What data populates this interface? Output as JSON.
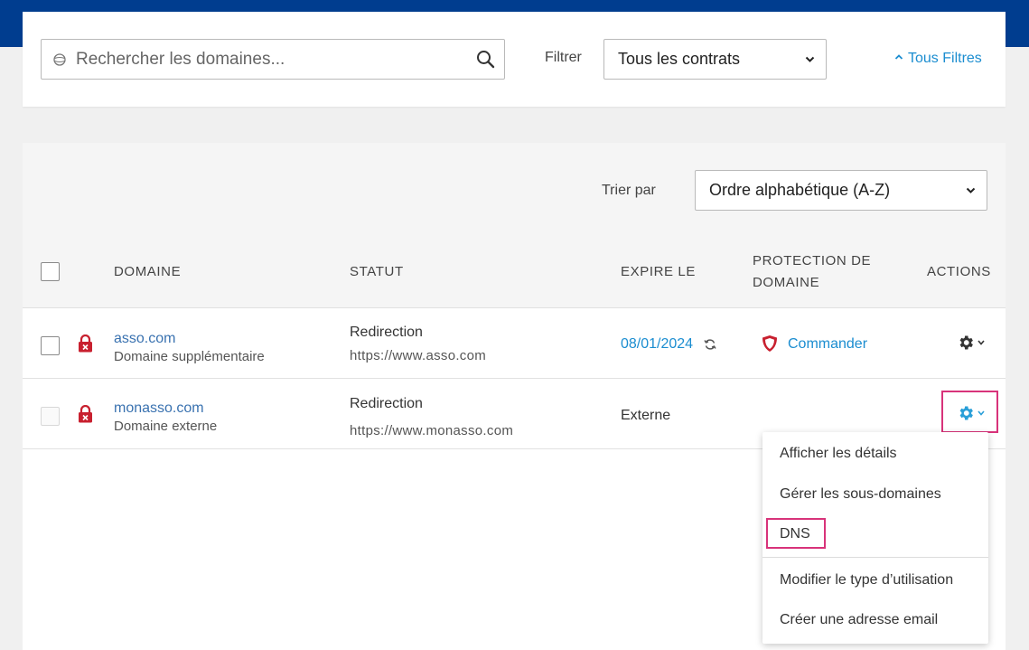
{
  "search": {
    "placeholder": "Rechercher les domaines...",
    "filter_label": "Filtrer",
    "contract_select": "Tous les contrats",
    "all_filters": "Tous Filtres"
  },
  "table": {
    "sort_label": "Trier par",
    "sort_select": "Ordre alphabétique (A-Z)",
    "headers": {
      "domain": "DOMAINE",
      "status": "STATUT",
      "expires": "EXPIRE LE",
      "protection_line1": "PROTECTION DE",
      "protection_line2": "DOMAINE",
      "actions": "ACTIONS"
    },
    "rows": [
      {
        "name": "asso.com",
        "type": "Domaine supplémentaire",
        "status": "Redirection",
        "status_url": "https://www.asso.com",
        "expires": "08/01/2024",
        "protection": "Commander"
      },
      {
        "name": "monasso.com",
        "type": "Domaine externe",
        "status": "Redirection",
        "status_url": "https://www.monasso.com",
        "expires": "Externe"
      }
    ]
  },
  "action_menu": {
    "items": [
      "Afficher les détails",
      "Gérer les sous-domaines",
      "DNS",
      "Modifier le type d’utilisation",
      "Créer une adresse email"
    ]
  },
  "colors": {
    "topbar": "#003d8f",
    "link": "#1b8dd0",
    "domain_link": "#3a72b0",
    "lock_red": "#c8202f",
    "highlight": "#d8337a",
    "gear_active": "#2a9fd8",
    "gear_default": "#333333"
  },
  "icons": [
    "globe-icon",
    "search-icon",
    "chevron-down-icon",
    "caret-up-icon",
    "lock-icon",
    "renew-icon",
    "shield-icon",
    "gear-icon"
  ]
}
